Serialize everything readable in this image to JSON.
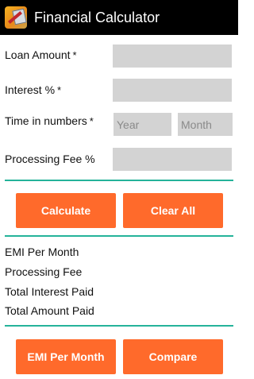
{
  "app": {
    "title": "Financial Calculator",
    "icon": "calculator-app-icon"
  },
  "form": {
    "loan_amount": {
      "label": "Loan Amount",
      "required_mark": "*",
      "value": ""
    },
    "interest": {
      "label": "Interest %",
      "required_mark": "*",
      "value": ""
    },
    "time": {
      "label": "Time in numbers",
      "required_mark": "*",
      "year_placeholder": "Year",
      "month_placeholder": "Month"
    },
    "processing_fee": {
      "label": "Processing Fee %",
      "value": ""
    }
  },
  "buttons": {
    "calculate": "Calculate",
    "clear_all": "Clear All",
    "emi_per_month": "EMI Per Month",
    "compare": "Compare"
  },
  "results": {
    "emi_per_month": "EMI Per Month",
    "processing_fee": "Processing Fee",
    "total_interest_paid": "Total Interest Paid",
    "total_amount_paid": "Total Amount Paid"
  },
  "colors": {
    "accent_button": "#ff6a2b",
    "divider": "#25b39a",
    "field_background": "#d3d3d3",
    "titlebar": "#000000"
  }
}
